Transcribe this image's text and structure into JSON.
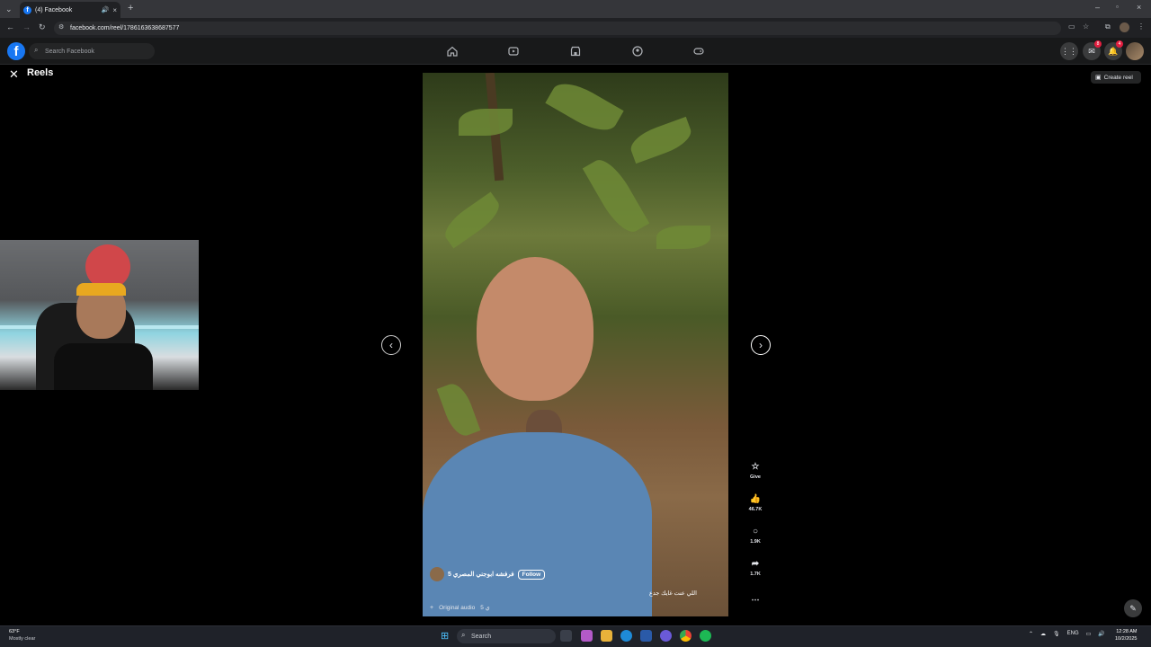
{
  "browser": {
    "tab_title": "(4) Facebook",
    "url": "facebook.com/reel/1786163638687577"
  },
  "fb": {
    "search_placeholder": "Search Facebook",
    "messenger_badge": "8",
    "notifications_badge": "4"
  },
  "reels": {
    "title": "Reels",
    "create_label": "Create reel"
  },
  "reel": {
    "author": "5 فرفشه ابوجني المصري",
    "follow_label": "Follow",
    "caption": "اللي عنت غايك جدع",
    "audio_label": "Original audio",
    "audio_extra": "5 ي"
  },
  "actions": {
    "give": "Give",
    "likes": "46.7K",
    "comments": "1.9K",
    "shares": "1.7K"
  },
  "taskbar": {
    "temp": "63°F",
    "weather": "Mostly clear",
    "search_label": "Search",
    "lang": "ENG",
    "time": "12:28 AM",
    "date": "10/2/2025"
  }
}
